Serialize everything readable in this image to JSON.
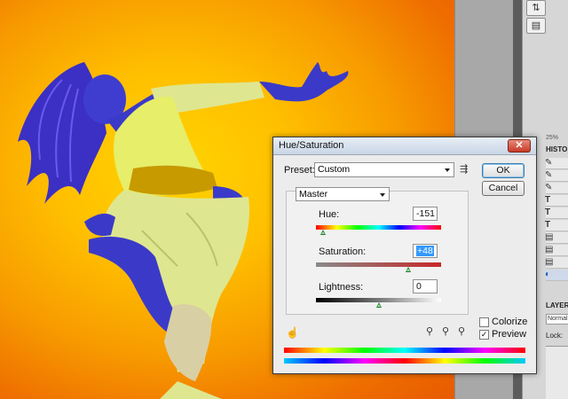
{
  "dialog": {
    "title": "Hue/Saturation",
    "close_label": "✕",
    "preset_label": "Preset:",
    "preset_value": "Custom",
    "channel_value": "Master",
    "ok_label": "OK",
    "cancel_label": "Cancel",
    "hue": {
      "label": "Hue:",
      "value": "-151",
      "slider_fraction": 0.06
    },
    "saturation": {
      "label": "Saturation:",
      "value": "+48",
      "slider_fraction": 0.74
    },
    "lightness": {
      "label": "Lightness:",
      "value": "0",
      "slider_fraction": 0.5
    },
    "colorize_label": "Colorize",
    "colorize_checked": false,
    "preview_label": "Preview",
    "preview_checked": true,
    "preview_check_glyph": "✓"
  },
  "dock": {
    "zoom": "25%",
    "history_label": "HISTO",
    "layers_label": "LAYERS",
    "blend_mode": "Normal",
    "lock_label": "Lock:"
  },
  "icons": {
    "preset_menu": "preset-options-icon",
    "hand_tool": "targeted-adjustment-icon",
    "eyedropper": "eyedropper-icon",
    "eyedropper_plus": "eyedropper-plus-icon",
    "eyedropper_minus": "eyedropper-minus-icon"
  },
  "colors": {
    "background_orange": "#f79a00",
    "figure_blue": "#3a3bc9",
    "clothing_yellow": "#dfe68c"
  }
}
